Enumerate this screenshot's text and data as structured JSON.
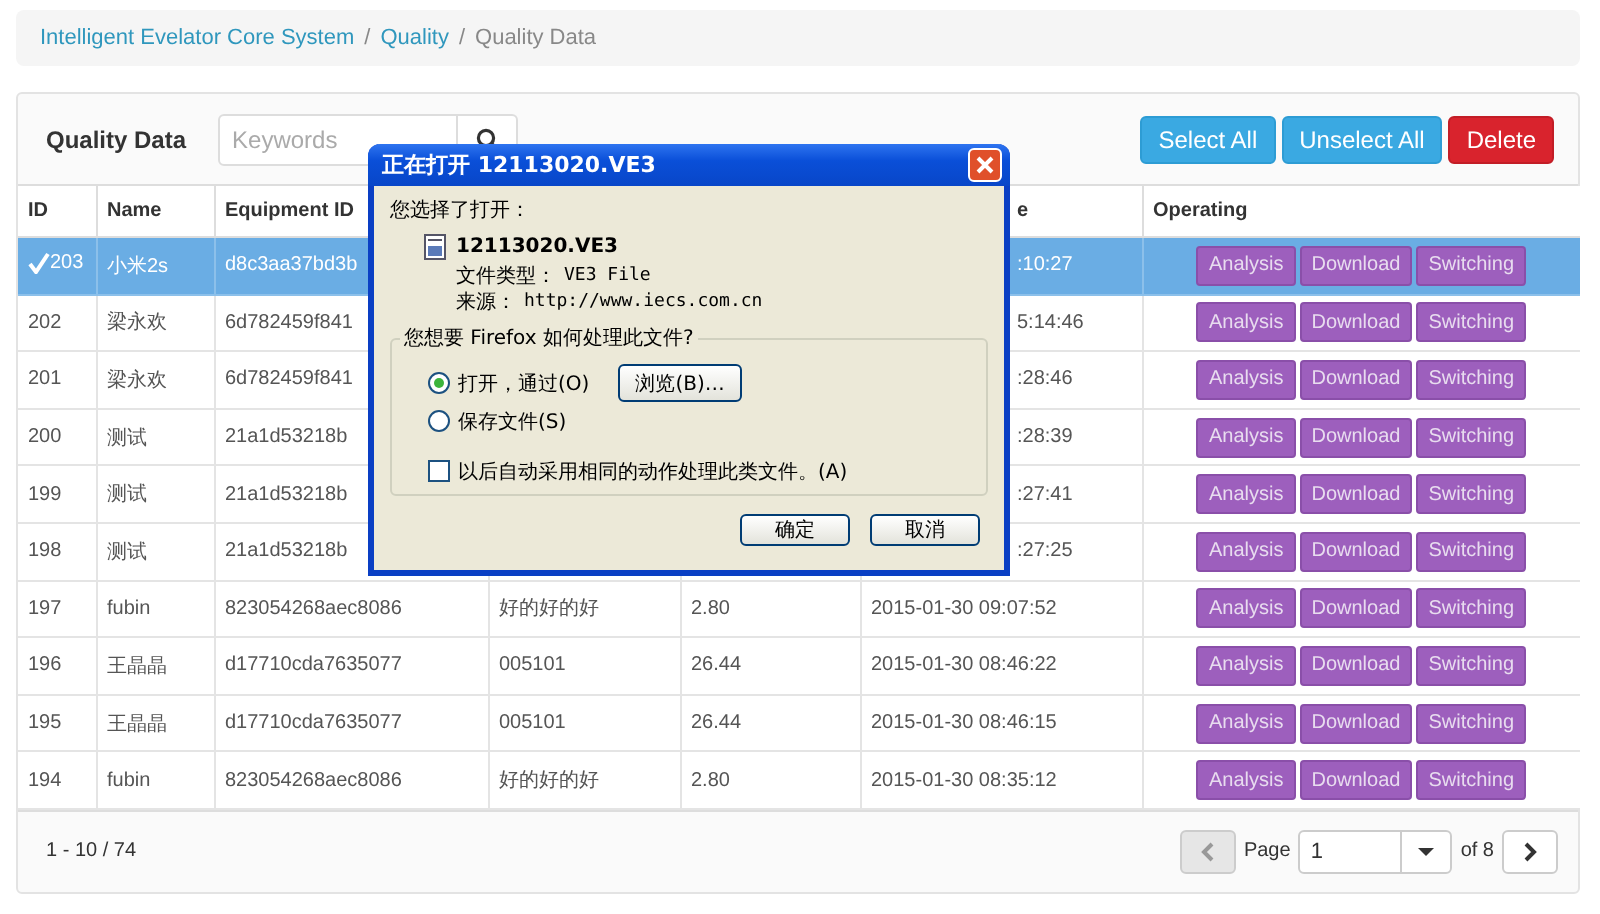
{
  "breadcrumb": [
    {
      "label": "Intelligent Evelator Core System",
      "link": true
    },
    {
      "separator": "/"
    },
    {
      "label": "Quality",
      "link": true
    },
    {
      "separator": "/"
    },
    {
      "label": "Quality Data",
      "link": false
    }
  ],
  "toolbar": {
    "title": "Quality Data",
    "search": {
      "placeholder": "Keywords"
    },
    "buttons": [
      {
        "label": "Select All",
        "kind": "primary"
      },
      {
        "label": "Unselect All",
        "kind": "primary"
      },
      {
        "label": "Delete",
        "kind": "danger"
      }
    ]
  },
  "table": {
    "columns": {
      "id": "ID",
      "name": "Name",
      "equipment_id": "Equipment ID",
      "column_6": "e",
      "operating": "Operating"
    },
    "rows": [
      {
        "id": "203",
        "name": "小米2s",
        "equipment_id": "d8c3aa37bd3b",
        "time": ":10:27",
        "covered": true,
        "selected": true,
        "actions": [
          "Analysis",
          "Download",
          "Switching"
        ]
      },
      {
        "id": "202",
        "name": "梁永欢",
        "equipment_id": "6d782459f841",
        "time": "5:14:46",
        "covered": true,
        "selected": false,
        "actions": [
          "Analysis",
          "Download",
          "Switching"
        ]
      },
      {
        "id": "201",
        "name": "梁永欢",
        "equipment_id": "6d782459f841",
        "time": ":28:46",
        "covered": true,
        "selected": false,
        "actions": [
          "Analysis",
          "Download",
          "Switching"
        ]
      },
      {
        "id": "200",
        "name": "测试",
        "equipment_id": "21a1d53218b",
        "time": ":28:39",
        "covered": true,
        "selected": false,
        "actions": [
          "Analysis",
          "Download",
          "Switching"
        ]
      },
      {
        "id": "199",
        "name": "测试",
        "equipment_id": "21a1d53218b",
        "time": ":27:41",
        "covered": true,
        "selected": false,
        "actions": [
          "Analysis",
          "Download",
          "Switching"
        ]
      },
      {
        "id": "198",
        "name": "测试",
        "equipment_id": "21a1d53218b",
        "time": ":27:25",
        "covered": true,
        "selected": false,
        "actions": [
          "Analysis",
          "Download",
          "Switching"
        ]
      },
      {
        "id": "197",
        "name": "fubin",
        "equipment_id": "823054268aec8086",
        "column_4": "好的好的好",
        "column_5": "2.80",
        "time": "2015-01-30 09:07:52",
        "covered": false,
        "selected": false,
        "actions": [
          "Analysis",
          "Download",
          "Switching"
        ]
      },
      {
        "id": "196",
        "name": "王晶晶",
        "equipment_id": "d17710cda7635077",
        "column_4": "005101",
        "column_5": "26.44",
        "time": "2015-01-30 08:46:22",
        "covered": false,
        "selected": false,
        "actions": [
          "Analysis",
          "Download",
          "Switching"
        ]
      },
      {
        "id": "195",
        "name": "王晶晶",
        "equipment_id": "d17710cda7635077",
        "column_4": "005101",
        "column_5": "26.44",
        "time": "2015-01-30 08:46:15",
        "covered": false,
        "selected": false,
        "actions": [
          "Analysis",
          "Download",
          "Switching"
        ]
      },
      {
        "id": "194",
        "name": "fubin",
        "equipment_id": "823054268aec8086",
        "column_4": "好的好的好",
        "column_5": "2.80",
        "time": "2015-01-30 08:35:12",
        "covered": false,
        "selected": false,
        "actions": [
          "Analysis",
          "Download",
          "Switching"
        ]
      }
    ]
  },
  "pagination": {
    "range": "1 - 10 / 74",
    "prev_disabled": true,
    "page_label": "Page",
    "page": "1",
    "of_label": "of 8"
  },
  "dialog": {
    "title": "正在打开 12113020.VE3",
    "intro": "您选择了打开：",
    "file_name": "12113020.VE3",
    "type_label": "文件类型：",
    "type_value": "VE3 File",
    "source_label": "来源：",
    "source_value": "http://www.iecs.com.cn",
    "group_title": "您想要 Firefox 如何处理此文件?",
    "options": [
      {
        "label": "打开，通过(O)",
        "selected": true,
        "browse": "浏览(B)…"
      },
      {
        "label": "保存文件(S)",
        "selected": false
      }
    ],
    "remember": {
      "label": "以后自动采用相同的动作处理此类文件。(A)",
      "checked": false
    },
    "buttons": [
      "确定",
      "取消"
    ]
  }
}
